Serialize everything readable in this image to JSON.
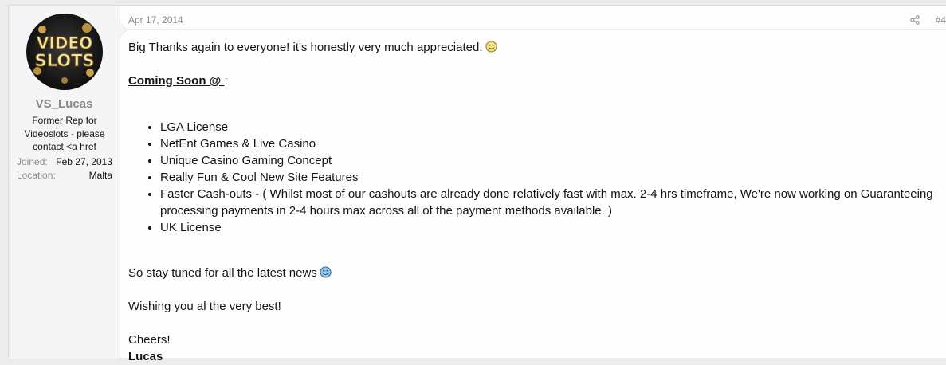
{
  "post": {
    "date": "Apr 17, 2014",
    "number": "#4",
    "share_icon": "share-icon"
  },
  "user": {
    "avatar_text": "VIDEO SLOTS",
    "name": "VS_Lucas",
    "title": "Former Rep for Videoslots - please contact <a href",
    "joined_label": "Joined:",
    "joined_value": "Feb 27, 2013",
    "location_label": "Location:",
    "location_value": "Malta"
  },
  "content": {
    "line1": "Big Thanks again to everyone! it's honestly very much appreciated.",
    "coming_soon": "Coming Soon @ ",
    "coming_soon_suffix": ":",
    "list": [
      "LGA License",
      "NetEnt Games & Live Casino",
      "Unique Casino Gaming Concept",
      "Really Fun & Cool New Site Features",
      "Faster Cash-outs - ( Whilst most of our cashouts are already done relatively fast with max. 2-4 hrs timeframe, We're now working on Guaranteeing processing payments in 2-4 hours max across all of the payment methods available. )",
      "UK License"
    ],
    "stay_tuned": "So stay tuned for all the latest news",
    "wishing": "Wishing you al the very best!",
    "cheers": "Cheers!",
    "signature": "Lucas"
  }
}
